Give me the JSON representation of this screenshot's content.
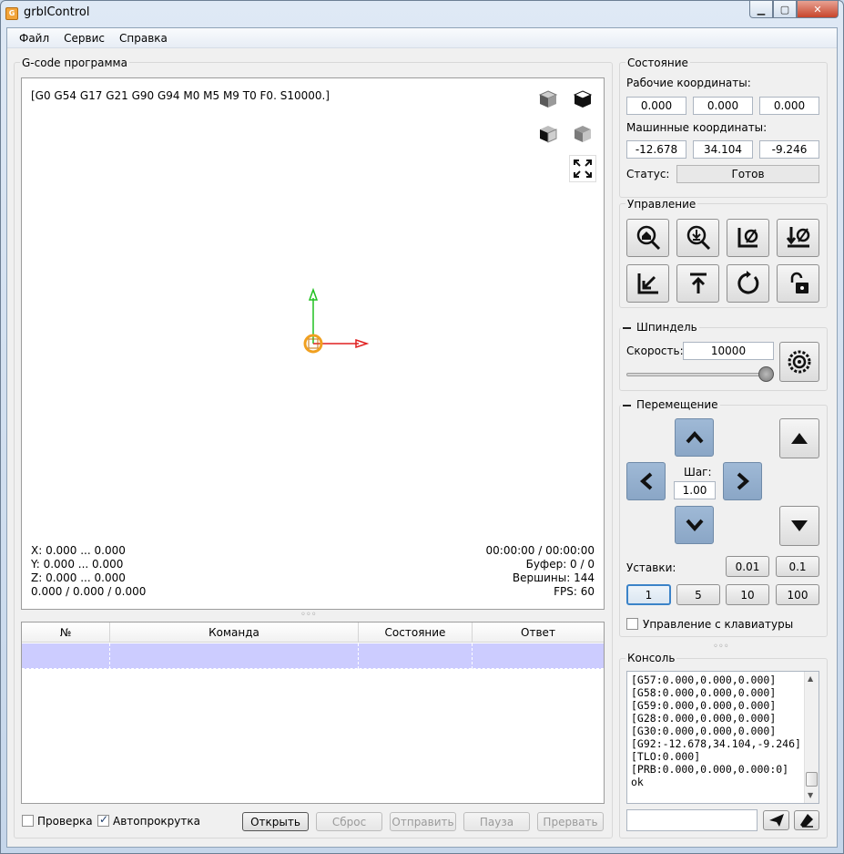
{
  "window": {
    "title": "grblControl",
    "icon_label": "G"
  },
  "menu": [
    "Файл",
    "Сервис",
    "Справка"
  ],
  "gcode_panel": {
    "title": "G-code программа",
    "state_line": "[G0 G54 G17 G21 G90 G94 M0 M5 M9 T0 F0. S10000.]",
    "ranges": {
      "x": "X: 0.000 ... 0.000",
      "y": "Y: 0.000 ... 0.000",
      "z": "Z: 0.000 ... 0.000",
      "xyz": "0.000 / 0.000 / 0.000"
    },
    "stats": {
      "time": "00:00:00 / 00:00:00",
      "buffer": "Буфер: 0 / 0",
      "vertices": "Вершины: 144",
      "fps": "FPS: 60"
    },
    "view_icons": [
      "cube-front-icon",
      "cube-iso-icon",
      "cube-left-icon",
      "cube-top-icon",
      "fit-view-icon"
    ]
  },
  "table": {
    "columns": [
      "№",
      "Команда",
      "Состояние",
      "Ответ"
    ],
    "rows": [
      [
        "",
        "",
        "",
        ""
      ]
    ]
  },
  "bottom_bar": {
    "check_label": "Проверка",
    "check_on": false,
    "autoscroll_label": "Автопрокрутка",
    "autoscroll_on": true,
    "buttons": {
      "open": "Открыть",
      "reset": "Сброс",
      "send": "Отправить",
      "pause": "Пауза",
      "abort": "Прервать"
    }
  },
  "state": {
    "title": "Состояние",
    "work_label": "Рабочие координаты:",
    "work": [
      "0.000",
      "0.000",
      "0.000"
    ],
    "machine_label": "Машинные координаты:",
    "machine": [
      "-12.678",
      "34.104",
      "-9.246"
    ],
    "status_label": "Статус:",
    "status": "Готов"
  },
  "control": {
    "title": "Управление",
    "icons": [
      "home-search-icon",
      "probe-search-icon",
      "zero-xy-icon",
      "zero-z-icon",
      "restore-origin-icon",
      "safe-position-icon",
      "reset-icon",
      "unlock-icon"
    ]
  },
  "spindle": {
    "title": "Шпиндель",
    "speed_label": "Скорость:",
    "speed": "10000",
    "slider_level": 1.0
  },
  "jog": {
    "title": "Перемещение",
    "step_label": "Шаг:",
    "step": "1.00",
    "presets_label": "Уставки:",
    "presets": [
      "0.01",
      "0.1",
      "1",
      "5",
      "10",
      "100"
    ],
    "selected_preset": "1",
    "keyboard_label": "Управление с клавиатуры",
    "keyboard_on": false
  },
  "console": {
    "title": "Консоль",
    "lines": [
      "[G57:0.000,0.000,0.000]",
      "[G58:0.000,0.000,0.000]",
      "[G59:0.000,0.000,0.000]",
      "[G28:0.000,0.000,0.000]",
      "[G30:0.000,0.000,0.000]",
      "[G92:-12.678,34.104,-9.246]",
      "[TLO:0.000]",
      "[PRB:0.000,0.000,0.000:0]",
      "ok"
    ],
    "input": ""
  },
  "colors": {
    "selection": "#ccccff",
    "axis_x": "#e02020",
    "axis_y": "#20c020",
    "tool": "#f0a020",
    "jog_button": "#9fb9d6"
  }
}
